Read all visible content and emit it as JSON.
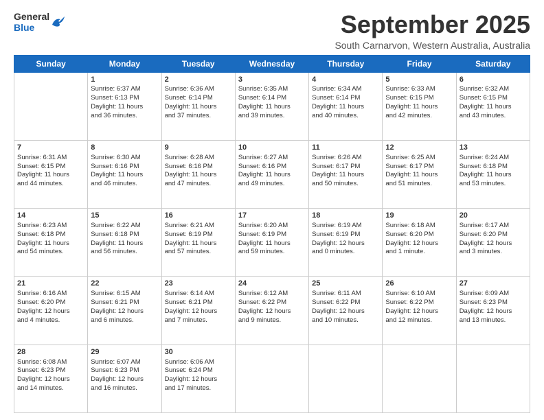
{
  "header": {
    "logo_general": "General",
    "logo_blue": "Blue",
    "main_title": "September 2025",
    "subtitle": "South Carnarvon, Western Australia, Australia"
  },
  "calendar": {
    "days_of_week": [
      "Sunday",
      "Monday",
      "Tuesday",
      "Wednesday",
      "Thursday",
      "Friday",
      "Saturday"
    ],
    "weeks": [
      [
        {
          "day": "",
          "content": ""
        },
        {
          "day": "1",
          "content": "Sunrise: 6:37 AM\nSunset: 6:13 PM\nDaylight: 11 hours\nand 36 minutes."
        },
        {
          "day": "2",
          "content": "Sunrise: 6:36 AM\nSunset: 6:14 PM\nDaylight: 11 hours\nand 37 minutes."
        },
        {
          "day": "3",
          "content": "Sunrise: 6:35 AM\nSunset: 6:14 PM\nDaylight: 11 hours\nand 39 minutes."
        },
        {
          "day": "4",
          "content": "Sunrise: 6:34 AM\nSunset: 6:14 PM\nDaylight: 11 hours\nand 40 minutes."
        },
        {
          "day": "5",
          "content": "Sunrise: 6:33 AM\nSunset: 6:15 PM\nDaylight: 11 hours\nand 42 minutes."
        },
        {
          "day": "6",
          "content": "Sunrise: 6:32 AM\nSunset: 6:15 PM\nDaylight: 11 hours\nand 43 minutes."
        }
      ],
      [
        {
          "day": "7",
          "content": "Sunrise: 6:31 AM\nSunset: 6:15 PM\nDaylight: 11 hours\nand 44 minutes."
        },
        {
          "day": "8",
          "content": "Sunrise: 6:30 AM\nSunset: 6:16 PM\nDaylight: 11 hours\nand 46 minutes."
        },
        {
          "day": "9",
          "content": "Sunrise: 6:28 AM\nSunset: 6:16 PM\nDaylight: 11 hours\nand 47 minutes."
        },
        {
          "day": "10",
          "content": "Sunrise: 6:27 AM\nSunset: 6:16 PM\nDaylight: 11 hours\nand 49 minutes."
        },
        {
          "day": "11",
          "content": "Sunrise: 6:26 AM\nSunset: 6:17 PM\nDaylight: 11 hours\nand 50 minutes."
        },
        {
          "day": "12",
          "content": "Sunrise: 6:25 AM\nSunset: 6:17 PM\nDaylight: 11 hours\nand 51 minutes."
        },
        {
          "day": "13",
          "content": "Sunrise: 6:24 AM\nSunset: 6:18 PM\nDaylight: 11 hours\nand 53 minutes."
        }
      ],
      [
        {
          "day": "14",
          "content": "Sunrise: 6:23 AM\nSunset: 6:18 PM\nDaylight: 11 hours\nand 54 minutes."
        },
        {
          "day": "15",
          "content": "Sunrise: 6:22 AM\nSunset: 6:18 PM\nDaylight: 11 hours\nand 56 minutes."
        },
        {
          "day": "16",
          "content": "Sunrise: 6:21 AM\nSunset: 6:19 PM\nDaylight: 11 hours\nand 57 minutes."
        },
        {
          "day": "17",
          "content": "Sunrise: 6:20 AM\nSunset: 6:19 PM\nDaylight: 11 hours\nand 59 minutes."
        },
        {
          "day": "18",
          "content": "Sunrise: 6:19 AM\nSunset: 6:19 PM\nDaylight: 12 hours\nand 0 minutes."
        },
        {
          "day": "19",
          "content": "Sunrise: 6:18 AM\nSunset: 6:20 PM\nDaylight: 12 hours\nand 1 minute."
        },
        {
          "day": "20",
          "content": "Sunrise: 6:17 AM\nSunset: 6:20 PM\nDaylight: 12 hours\nand 3 minutes."
        }
      ],
      [
        {
          "day": "21",
          "content": "Sunrise: 6:16 AM\nSunset: 6:20 PM\nDaylight: 12 hours\nand 4 minutes."
        },
        {
          "day": "22",
          "content": "Sunrise: 6:15 AM\nSunset: 6:21 PM\nDaylight: 12 hours\nand 6 minutes."
        },
        {
          "day": "23",
          "content": "Sunrise: 6:14 AM\nSunset: 6:21 PM\nDaylight: 12 hours\nand 7 minutes."
        },
        {
          "day": "24",
          "content": "Sunrise: 6:12 AM\nSunset: 6:22 PM\nDaylight: 12 hours\nand 9 minutes."
        },
        {
          "day": "25",
          "content": "Sunrise: 6:11 AM\nSunset: 6:22 PM\nDaylight: 12 hours\nand 10 minutes."
        },
        {
          "day": "26",
          "content": "Sunrise: 6:10 AM\nSunset: 6:22 PM\nDaylight: 12 hours\nand 12 minutes."
        },
        {
          "day": "27",
          "content": "Sunrise: 6:09 AM\nSunset: 6:23 PM\nDaylight: 12 hours\nand 13 minutes."
        }
      ],
      [
        {
          "day": "28",
          "content": "Sunrise: 6:08 AM\nSunset: 6:23 PM\nDaylight: 12 hours\nand 14 minutes."
        },
        {
          "day": "29",
          "content": "Sunrise: 6:07 AM\nSunset: 6:23 PM\nDaylight: 12 hours\nand 16 minutes."
        },
        {
          "day": "30",
          "content": "Sunrise: 6:06 AM\nSunset: 6:24 PM\nDaylight: 12 hours\nand 17 minutes."
        },
        {
          "day": "",
          "content": ""
        },
        {
          "day": "",
          "content": ""
        },
        {
          "day": "",
          "content": ""
        },
        {
          "day": "",
          "content": ""
        }
      ]
    ]
  }
}
